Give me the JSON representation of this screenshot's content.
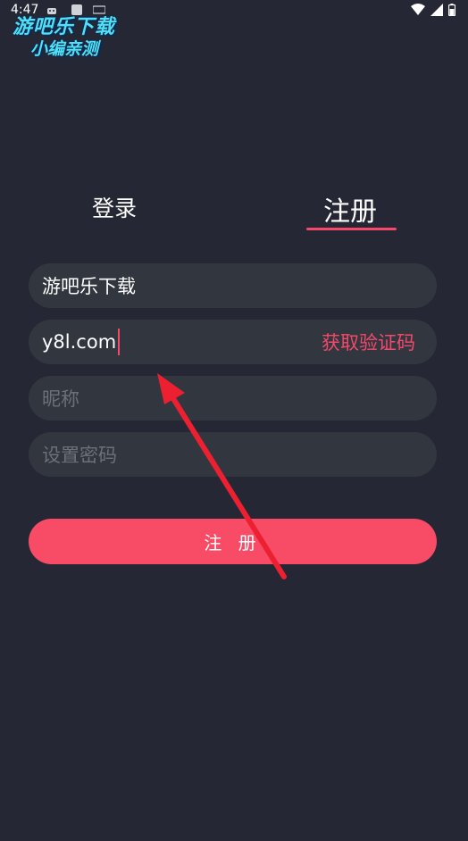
{
  "status_bar": {
    "time": "4:47"
  },
  "watermark": {
    "line1": "游吧乐下载",
    "line2": "小编亲测"
  },
  "tabs": {
    "login": "登录",
    "register": "注册"
  },
  "form": {
    "account_value": "游吧乐下载",
    "email_value": "y8l.com",
    "get_code_label": "获取验证码",
    "nickname_placeholder": "昵称",
    "password_placeholder": "设置密码"
  },
  "register_button_label": "注 册",
  "colors": {
    "background": "#252834",
    "field": "#32363f",
    "accent": "#f84b66",
    "watermark": "#4fe0f5"
  }
}
